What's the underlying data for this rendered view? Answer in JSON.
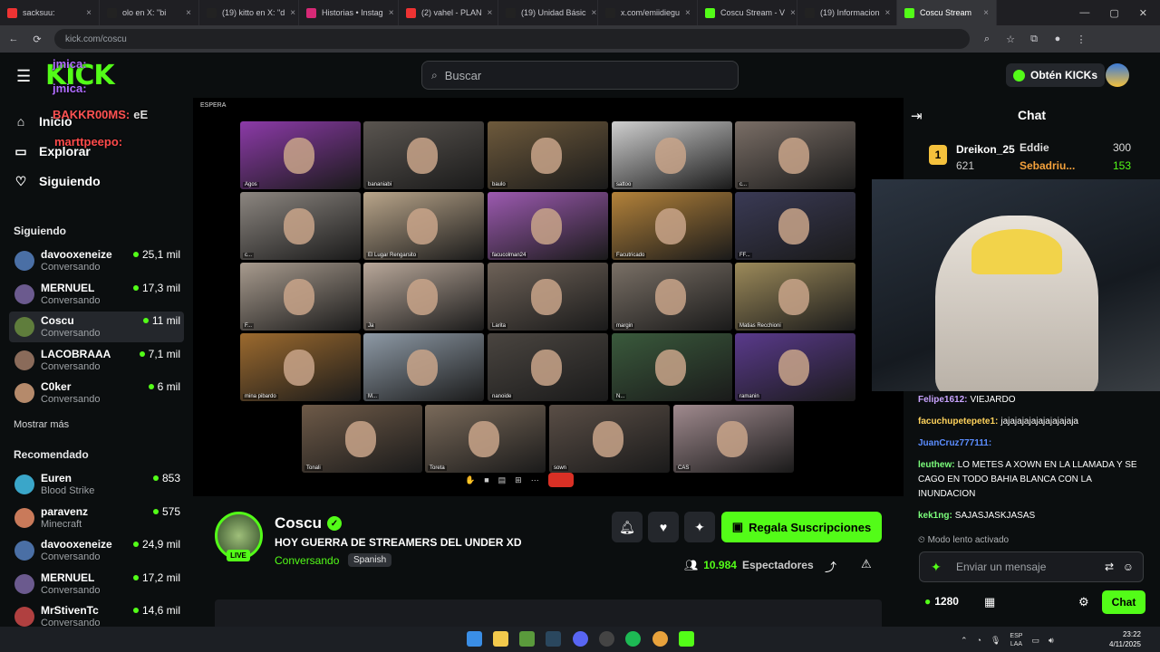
{
  "browser": {
    "tabs": [
      {
        "label": "sacksuu:",
        "fav": "#e33",
        "active": false
      },
      {
        "label": "olo en X: \"bi",
        "fav": "#222",
        "active": false
      },
      {
        "label": "(19) kitto en X: \"d",
        "fav": "#222",
        "active": false
      },
      {
        "label": "Historias • Instag",
        "fav": "#d62976",
        "active": false
      },
      {
        "label": "(2) vahel - PLAN",
        "fav": "#e33",
        "active": false
      },
      {
        "label": "(19) Unidad Básic",
        "fav": "#222",
        "active": false
      },
      {
        "label": "x.com/emiidiegu",
        "fav": "#222",
        "active": false
      },
      {
        "label": "Coscu Stream - V",
        "fav": "#53fc18",
        "active": false
      },
      {
        "label": "(19) Informacion",
        "fav": "#222",
        "active": false
      },
      {
        "label": "Coscu Stream",
        "fav": "#53fc18",
        "active": true
      }
    ],
    "url": "kick.com/coscu"
  },
  "header": {
    "logo": "KICK",
    "search_placeholder": "Buscar",
    "kicks_button": "Obtén KICKs"
  },
  "overlay_chat": [
    {
      "user": "jmica:",
      "text": "",
      "color": "#b06cff"
    },
    {
      "user": "jmica:",
      "text": "",
      "color": "#b06cff"
    },
    {
      "user": "BAKKR00MS:",
      "text": "eE",
      "color": "#ff5252"
    },
    {
      "user": "marttpeepo:",
      "text": "",
      "color": "#ff4b4b"
    },
    {
      "user": "marttpeepo:",
      "text": "",
      "color": "#ff4b4b"
    }
  ],
  "sidebar": {
    "nav": [
      {
        "label": "Inicio",
        "icon": "home-icon"
      },
      {
        "label": "Explorar",
        "icon": "compass-icon"
      },
      {
        "label": "Siguiendo",
        "icon": "heart-icon"
      }
    ],
    "following_title": "Siguiendo",
    "following": [
      {
        "name": "davooxeneize",
        "sub": "Conversando",
        "viewers": "25,1 mil",
        "color": "#4a6fa5"
      },
      {
        "name": "MERNUEL",
        "sub": "Conversando",
        "viewers": "17,3 mil",
        "color": "#6b5a8e"
      },
      {
        "name": "Coscu",
        "sub": "Conversando",
        "viewers": "11 mil",
        "color": "#5f7d3c"
      },
      {
        "name": "LACOBRAAA",
        "sub": "Conversando",
        "viewers": "7,1 mil",
        "color": "#8a6b5a"
      },
      {
        "name": "C0ker",
        "sub": "Conversando",
        "viewers": "6 mil",
        "color": "#b58a6b"
      }
    ],
    "show_more": "Mostrar más",
    "recommended_title": "Recomendado",
    "recommended": [
      {
        "name": "Euren",
        "sub": "Blood Strike",
        "viewers": "853",
        "color": "#3aa6c9"
      },
      {
        "name": "paravenz",
        "sub": "Minecraft",
        "viewers": "575",
        "color": "#c97a5a"
      },
      {
        "name": "davooxeneize",
        "sub": "Conversando",
        "viewers": "24,9 mil",
        "color": "#4a6fa5"
      },
      {
        "name": "MERNUEL",
        "sub": "Conversando",
        "viewers": "17,2 mil",
        "color": "#6b5a8e"
      },
      {
        "name": "MrStivenTc",
        "sub": "Conversando",
        "viewers": "14,6 mil",
        "color": "#b04040"
      }
    ]
  },
  "player": {
    "status": "ESPERA",
    "participants": [
      {
        "name": "Agos",
        "color": "#8c3aa8"
      },
      {
        "name": "bananiabi",
        "color": "#5a5550"
      },
      {
        "name": "baulo",
        "color": "#6e5a3c"
      },
      {
        "name": "sattoo",
        "color": "#cfcfcf"
      },
      {
        "name": "c...",
        "color": "#7a6e66"
      },
      {
        "name": "c...",
        "color": "#8c8680"
      },
      {
        "name": "El Lugar Rengarsito",
        "color": "#b9a58a"
      },
      {
        "name": "facucolman24",
        "color": "#9c5ab0"
      },
      {
        "name": "Facutricado",
        "color": "#b3823a"
      },
      {
        "name": "FF...",
        "color": "#3a3a55"
      },
      {
        "name": "F...",
        "color": "#a89b8e"
      },
      {
        "name": "Ja",
        "color": "#b9a89a"
      },
      {
        "name": "Larita",
        "color": "#6e6258"
      },
      {
        "name": "margin",
        "color": "#7a7066"
      },
      {
        "name": "Matias Recchioni",
        "color": "#9c8a5a"
      },
      {
        "name": "mina pibardo",
        "color": "#9c6a2e"
      },
      {
        "name": "M...",
        "color": "#8e9aa6"
      },
      {
        "name": "nanoide",
        "color": "#4a4540"
      },
      {
        "name": "N...",
        "color": "#3a5a3c"
      },
      {
        "name": "ramanin",
        "color": "#5a3a8c"
      },
      {
        "name": "Tonali",
        "color": "#6e5a48"
      },
      {
        "name": "Toreta",
        "color": "#7a6a5a"
      },
      {
        "name": "sown",
        "color": "#5a4e46"
      },
      {
        "name": "CAS",
        "color": "#a08a8e"
      }
    ]
  },
  "stream": {
    "name": "Coscu",
    "title": "HOY GUERRA DE STREAMERS DEL UNDER XD",
    "category": "Conversando",
    "language": "Spanish",
    "live_badge": "LIVE",
    "gift_button": "Regala Suscripciones",
    "viewers": "10.984",
    "viewers_label": "Espectadores"
  },
  "chat": {
    "title": "Chat",
    "leaderboard": [
      {
        "rank": "1",
        "user": "Dreikon_25",
        "score": "621"
      },
      {
        "user": "Eddie",
        "score": "300"
      },
      {
        "user": "Sebadriu...",
        "score": "153"
      }
    ],
    "messages": [
      {
        "user": "Felipe1612:",
        "text": "VIEJARDO",
        "color": "#c9a4ff"
      },
      {
        "user": "facuchupetepete1:",
        "text": "jajajajajajajajajajaja",
        "color": "#ffd35c"
      },
      {
        "user": "JuanCruz777111:",
        "text": "",
        "color": "#5b8dff"
      },
      {
        "user": "leuthew:",
        "text": "LO METES A XOWN EN LA LLAMADA Y SE CAGO EN TODO BAHIA BLANCA CON LA INUNDACION",
        "color": "#7cff7c"
      },
      {
        "user": "kek1ng:",
        "text": "SAJASJASKJASAS",
        "color": "#7cff7c"
      }
    ],
    "slow_mode": "Modo lento activado",
    "input_placeholder": "Enviar un mensaje",
    "points": "1280",
    "chat_button": "Chat"
  },
  "taskbar": {
    "lang": "ESP",
    "lang2": "LAA",
    "time": "23:22",
    "date": "4/11/2025"
  },
  "colors": {
    "accent": "#53fc18"
  }
}
